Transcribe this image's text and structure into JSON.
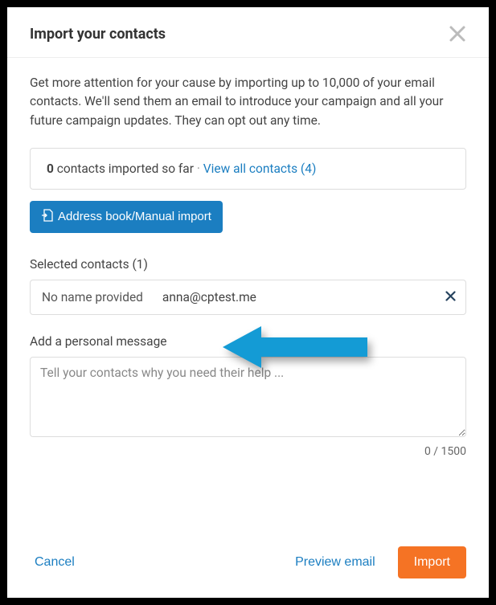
{
  "modal": {
    "title": "Import your contacts",
    "intro": "Get more attention for your cause by importing up to 10,000 of your email contacts. We'll send them an email to introduce your campaign and all your future campaign updates. They can opt out any time.",
    "import_status": {
      "count": "0",
      "suffix": " contacts imported so far",
      "separator": " · ",
      "view_all": "View all contacts (4)"
    },
    "address_book_button": "Address book/Manual import",
    "selected_contacts_label": "Selected contacts (1)",
    "contacts": [
      {
        "name": "No name provided",
        "email": "anna@cptest.me"
      }
    ],
    "message_label": "Add a personal message",
    "message_placeholder": "Tell your contacts why you need their help ...",
    "counter": "0 / 1500",
    "footer": {
      "cancel": "Cancel",
      "preview": "Preview email",
      "import": "Import"
    }
  }
}
